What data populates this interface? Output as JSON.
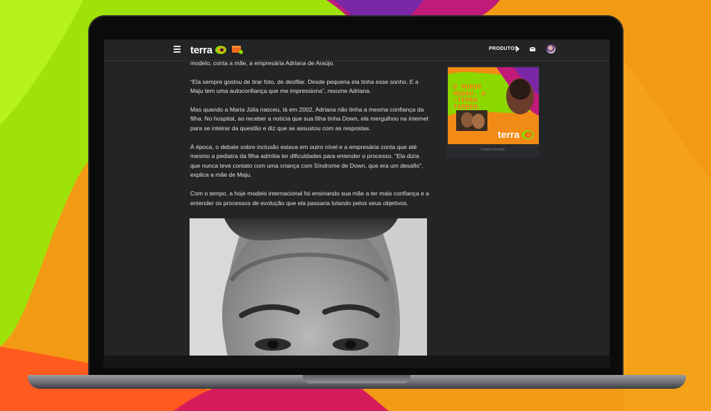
{
  "header": {
    "logo_text": "terra",
    "products_label": "PRODUTOS"
  },
  "article": {
    "paragraphs": [
      "modelo, conta a mãe, a empresária Adriana de Araújo.",
      "“Ela sempre gostou de tirar foto, de desfilar. Desde pequena ela tinha esse sonho. E a Maju tem uma autoconfiança que me impressiona”, resume Adriana.",
      "Mas quando a Maria Júlia nasceu, lá em 2002, Adriana não tinha a mesma confiança da filha. No hospital, ao receber a notícia que sua filha tinha Down, ela mergulhou na internet para se inteirar da questão e diz que se assustou com as respostas.",
      "À época, o debate sobre inclusão estava em outro nível e a empresária conta que até mesmo a pediatra da filha admitia ter dificuldades para entender o processo. “Ela dizia que nunca teve contato com uma criança com Síndrome de Down, que era um desafio”, explica a mãe de Maju.",
      "Com o tempo, a hoje modelo internacional foi ensinando sua mãe a ter mais confiança e a entender os processos de evolução que ela passaria lutando pelos seus objetivos."
    ]
  },
  "ad": {
    "headline": "O MUNDO MUDOU. O →TERRA TAMBÉM.",
    "logo_text": "terra",
    "label": "PUBLICIDADE"
  },
  "colors": {
    "brand_green": "#8bd800",
    "brand_orange": "#f39a14",
    "page_dark": "#232426"
  }
}
